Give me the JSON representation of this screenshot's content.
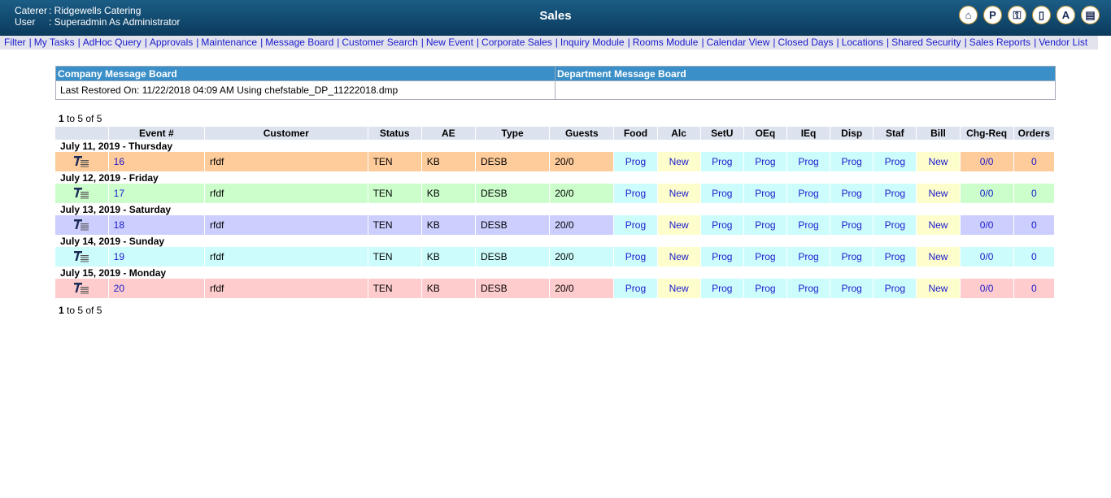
{
  "header": {
    "caterer_label": "Caterer",
    "caterer_value": ": Ridgewells Catering",
    "user_label": "User",
    "user_value": ": Superadmin As Administrator",
    "title": "Sales",
    "icons": [
      "home-icon",
      "p-icon",
      "key-icon",
      "door-icon",
      "a-icon",
      "book-icon"
    ],
    "icon_letters": [
      "⌂",
      "P",
      "⚿",
      "▯",
      "A",
      "▤"
    ]
  },
  "nav": [
    "Filter",
    "My Tasks",
    "AdHoc Query",
    "Approvals",
    "Maintenance",
    "Message Board",
    "Customer Search",
    "New Event",
    "Corporate Sales",
    "Inquiry Module",
    "Rooms Module",
    "Calendar View",
    "Closed Days",
    "Locations",
    "Shared Security",
    "Sales Reports",
    "Vendor List"
  ],
  "message_board": {
    "company_title": "Company Message Board",
    "department_title": "Department Message Board",
    "company_text": "Last Restored On: 11/22/2018 04:09 AM Using chefstable_DP_11222018.dmp"
  },
  "paging": {
    "start": "1",
    "rest": " to 5 of 5"
  },
  "columns": [
    "",
    "Event #",
    "Customer",
    "Status",
    "AE",
    "Type",
    "Guests",
    "Food",
    "Alc",
    "SetU",
    "OEq",
    "IEq",
    "Disp",
    "Staf",
    "Bill",
    "Chg-Req",
    "Orders"
  ],
  "groups": [
    {
      "date": "July 11, 2019 - Thursday",
      "color": "#fecb9a",
      "event": {
        "num": "16",
        "customer": "rfdf",
        "status": "TEN",
        "ae": "KB",
        "type": "DESB",
        "guests": "20/0",
        "stages": [
          "Prog",
          "New",
          "Prog",
          "Prog",
          "Prog",
          "Prog",
          "Prog",
          "New"
        ],
        "chg": "0/0",
        "orders": "0"
      }
    },
    {
      "date": "July 12, 2019 - Friday",
      "color": "#ccfecc",
      "event": {
        "num": "17",
        "customer": "rfdf",
        "status": "TEN",
        "ae": "KB",
        "type": "DESB",
        "guests": "20/0",
        "stages": [
          "Prog",
          "New",
          "Prog",
          "Prog",
          "Prog",
          "Prog",
          "Prog",
          "New"
        ],
        "chg": "0/0",
        "orders": "0"
      }
    },
    {
      "date": "July 13, 2019 - Saturday",
      "color": "#cccefe",
      "event": {
        "num": "18",
        "customer": "rfdf",
        "status": "TEN",
        "ae": "KB",
        "type": "DESB",
        "guests": "20/0",
        "stages": [
          "Prog",
          "New",
          "Prog",
          "Prog",
          "Prog",
          "Prog",
          "Prog",
          "New"
        ],
        "chg": "0/0",
        "orders": "0"
      }
    },
    {
      "date": "July 14, 2019 - Sunday",
      "color": "#cdfcfc",
      "event": {
        "num": "19",
        "customer": "rfdf",
        "status": "TEN",
        "ae": "KB",
        "type": "DESB",
        "guests": "20/0",
        "stages": [
          "Prog",
          "New",
          "Prog",
          "Prog",
          "Prog",
          "Prog",
          "Prog",
          "New"
        ],
        "chg": "0/0",
        "orders": "0"
      }
    },
    {
      "date": "July 15, 2019 - Monday",
      "color": "#fecccc",
      "event": {
        "num": "20",
        "customer": "rfdf",
        "status": "TEN",
        "ae": "KB",
        "type": "DESB",
        "guests": "20/0",
        "stages": [
          "Prog",
          "New",
          "Prog",
          "Prog",
          "Prog",
          "Prog",
          "Prog",
          "New"
        ],
        "chg": "0/0",
        "orders": "0"
      }
    }
  ]
}
